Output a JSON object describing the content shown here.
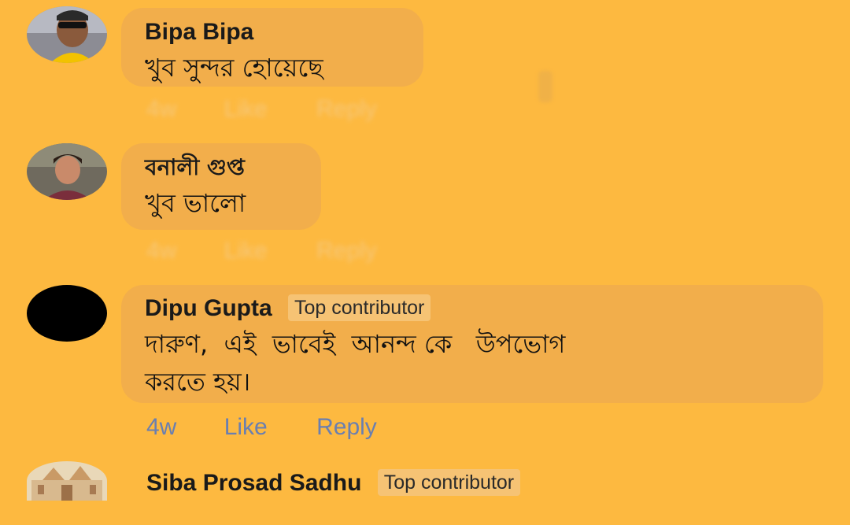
{
  "comments": [
    {
      "author": "Bipa Bipa",
      "badge": "",
      "text": "খুব সুন্দর হোয়েছে",
      "actions": {
        "time": "4w",
        "like": "Like",
        "reply": "Reply"
      },
      "avatar": "profile-photo"
    },
    {
      "author": "বনালী গুপ্ত",
      "badge": "",
      "text": "খুব ভালো",
      "actions": {
        "time": "4w",
        "like": "Like",
        "reply": "Reply"
      },
      "avatar": "profile-photo"
    },
    {
      "author": "Dipu Gupta",
      "badge": "Top contributor",
      "text": "দারুণ,  এই  ভাবেই  আনন্দ কে   উপভোগ\nকরতে হয়।",
      "actions": {
        "time": "4w",
        "like": "Like",
        "reply": "Reply"
      },
      "avatar": "black-circle"
    },
    {
      "author": "Siba Prosad Sadhu",
      "badge": "Top contributor",
      "avatar": "temple-photo"
    }
  ],
  "colors": {
    "background": "#FDB940",
    "bubble": "#F2AE4B",
    "badge": "#F6C374",
    "action_text": "#6A7FB0"
  }
}
